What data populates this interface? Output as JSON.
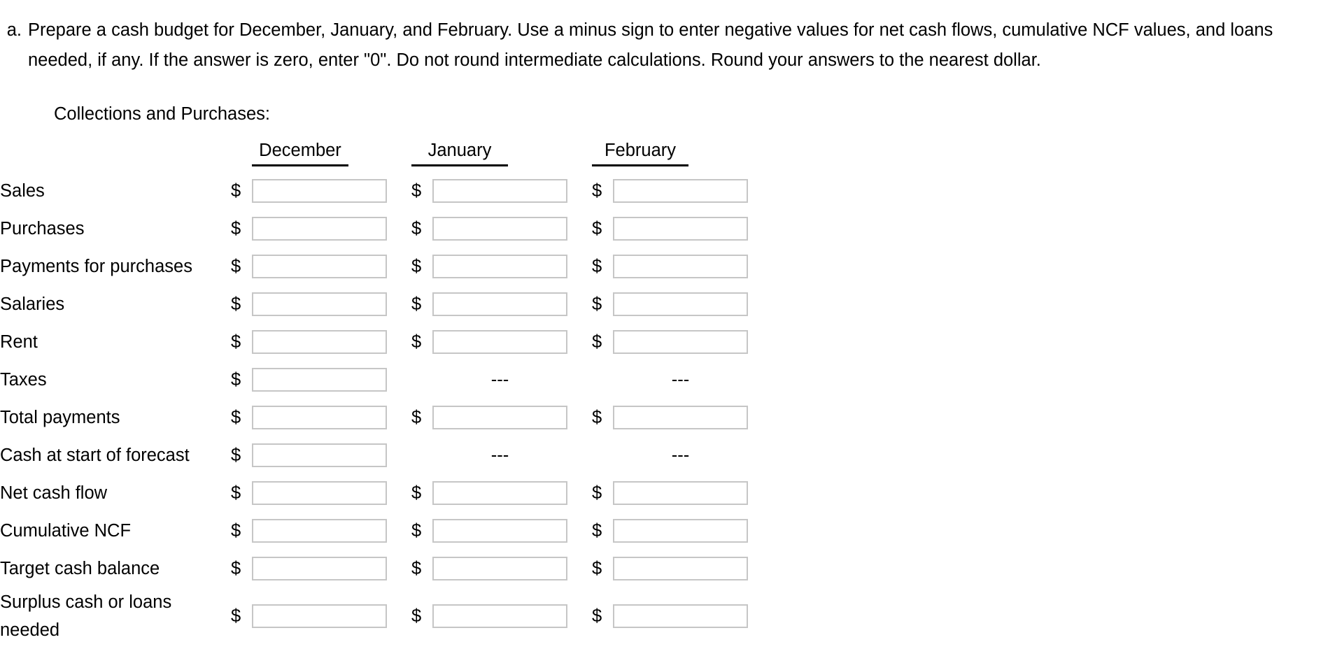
{
  "question": {
    "marker": "a.",
    "text": "Prepare a cash budget for December, January, and February. Use a minus sign to enter negative values for net cash flows, cumulative NCF values, and loans needed, if any. If the answer is zero, enter \"0\". Do not round intermediate calculations. Round your answers to the nearest dollar."
  },
  "section_label": "Collections and Purchases:",
  "currency_symbol": "$",
  "dash_placeholder": "---",
  "columns": [
    {
      "key": "december",
      "label": "December"
    },
    {
      "key": "january",
      "label": "January"
    },
    {
      "key": "february",
      "label": "February"
    }
  ],
  "rows": [
    {
      "label": "Sales",
      "cells": [
        {
          "type": "input",
          "value": "",
          "placeholder": ""
        },
        {
          "type": "input",
          "value": "",
          "placeholder": ""
        },
        {
          "type": "input",
          "value": "",
          "placeholder": ""
        }
      ]
    },
    {
      "label": "Purchases",
      "cells": [
        {
          "type": "input",
          "value": "",
          "placeholder": ""
        },
        {
          "type": "input",
          "value": "",
          "placeholder": ""
        },
        {
          "type": "input",
          "value": "",
          "placeholder": ""
        }
      ]
    },
    {
      "label": "Payments for purchases",
      "cells": [
        {
          "type": "input",
          "value": "",
          "placeholder": ""
        },
        {
          "type": "input",
          "value": "",
          "placeholder": ""
        },
        {
          "type": "input",
          "value": "",
          "placeholder": ""
        }
      ]
    },
    {
      "label": "Salaries",
      "cells": [
        {
          "type": "input",
          "value": "",
          "placeholder": ""
        },
        {
          "type": "input",
          "value": "",
          "placeholder": ""
        },
        {
          "type": "input",
          "value": "",
          "placeholder": ""
        }
      ]
    },
    {
      "label": "Rent",
      "cells": [
        {
          "type": "input",
          "value": "",
          "placeholder": ""
        },
        {
          "type": "input",
          "value": "",
          "placeholder": ""
        },
        {
          "type": "input",
          "value": "",
          "placeholder": ""
        }
      ]
    },
    {
      "label": "Taxes",
      "cells": [
        {
          "type": "input",
          "value": "",
          "placeholder": ""
        },
        {
          "type": "dash"
        },
        {
          "type": "dash"
        }
      ]
    },
    {
      "label": "Total payments",
      "cells": [
        {
          "type": "input",
          "value": "",
          "placeholder": ""
        },
        {
          "type": "input",
          "value": "",
          "placeholder": ""
        },
        {
          "type": "input",
          "value": "",
          "placeholder": ""
        }
      ]
    },
    {
      "label": "Cash at start of forecast",
      "cells": [
        {
          "type": "input",
          "value": "",
          "placeholder": ""
        },
        {
          "type": "dash"
        },
        {
          "type": "dash"
        }
      ]
    },
    {
      "label": "Net cash flow",
      "cells": [
        {
          "type": "input",
          "value": "",
          "placeholder": ""
        },
        {
          "type": "input",
          "value": "",
          "placeholder": ""
        },
        {
          "type": "input",
          "value": "",
          "placeholder": ""
        }
      ]
    },
    {
      "label": "Cumulative NCF",
      "cells": [
        {
          "type": "input",
          "value": "",
          "placeholder": ""
        },
        {
          "type": "input",
          "value": "",
          "placeholder": ""
        },
        {
          "type": "input",
          "value": "",
          "placeholder": ""
        }
      ]
    },
    {
      "label": "Target cash balance",
      "cells": [
        {
          "type": "input",
          "value": "",
          "placeholder": ""
        },
        {
          "type": "input",
          "value": "",
          "placeholder": ""
        },
        {
          "type": "input",
          "value": "",
          "placeholder": ""
        }
      ]
    },
    {
      "label": "Surplus cash or loans needed",
      "tall": true,
      "cells": [
        {
          "type": "input",
          "value": "",
          "placeholder": ""
        },
        {
          "type": "input",
          "value": "",
          "placeholder": ""
        },
        {
          "type": "input",
          "value": "",
          "placeholder": ""
        }
      ]
    }
  ],
  "colors": {
    "input_border": "#c6c6c6",
    "text": "#000000",
    "background": "#ffffff",
    "header_rule": "#000000"
  }
}
